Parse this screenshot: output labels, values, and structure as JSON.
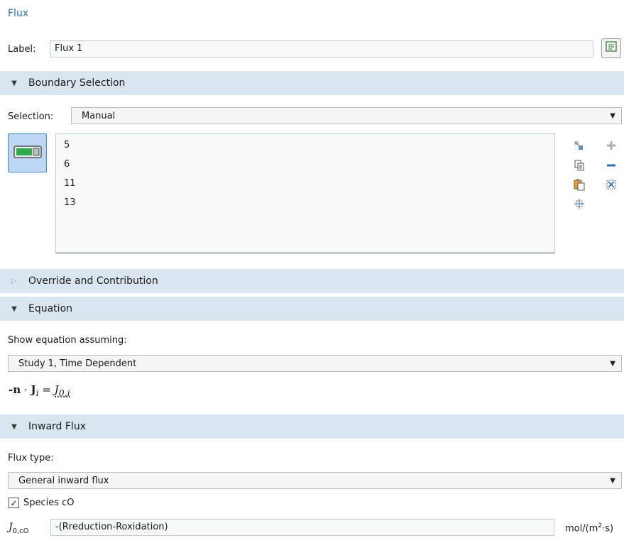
{
  "title": "Flux",
  "label": {
    "caption": "Label:",
    "value": "Flux 1"
  },
  "sections": {
    "boundary": "Boundary Selection",
    "override": "Override and Contribution",
    "equation": "Equation",
    "inward": "Inward Flux"
  },
  "selection": {
    "caption": "Selection:",
    "value": "Manual",
    "items": [
      "5",
      "6",
      "11",
      "13"
    ]
  },
  "equation": {
    "caption": "Show equation assuming:",
    "study": "Study 1, Time Dependent",
    "lhs_minus": "-",
    "lhs_n": "n",
    "lhs_dot": " · ",
    "lhs_J": "J",
    "lhs_sub": "i",
    "equals": " = ",
    "rhs_J": "J",
    "rhs_sub": "0,i"
  },
  "flux": {
    "type_caption": "Flux type:",
    "type_value": "General inward flux",
    "species_label": "Species cO",
    "species_checked": true,
    "j_symbol": "J",
    "j_sub": "0,cO",
    "j_value": "-(Rreduction-Roxidation)",
    "unit_main": "mol/(m",
    "unit_sup": "2",
    "unit_tail": "·s)"
  },
  "colors": {
    "section_bg": "#dae6ef",
    "title": "#2a6fb6",
    "field_bg": "#f7fbf7"
  },
  "icons": {
    "label_button": "comment-icon",
    "selection_toggle": "toggle-active-icon",
    "side": [
      "select-from-graphics-icon",
      "copy-icon",
      "paste-icon",
      "zoom-to-selection-icon",
      "add-icon",
      "remove-icon",
      "clear-selection-icon"
    ]
  }
}
